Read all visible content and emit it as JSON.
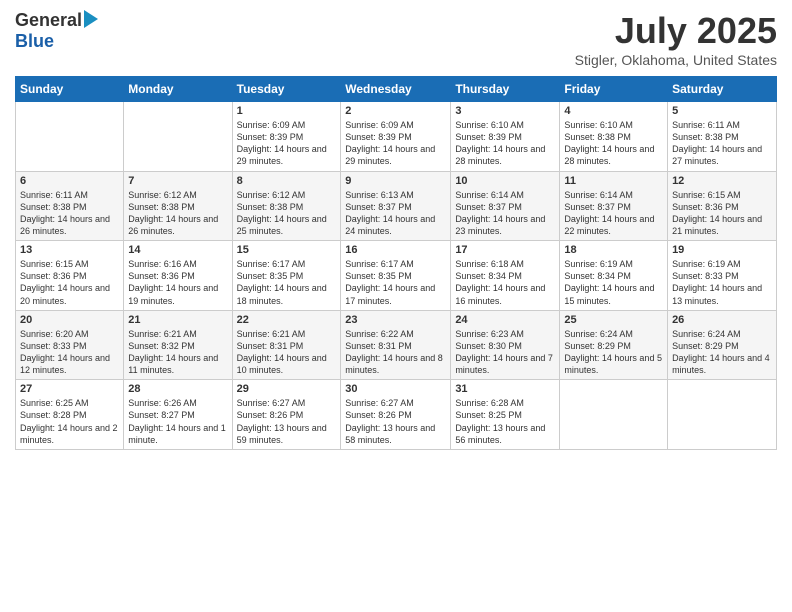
{
  "logo": {
    "general": "General",
    "blue": "Blue"
  },
  "title": "July 2025",
  "subtitle": "Stigler, Oklahoma, United States",
  "days_of_week": [
    "Sunday",
    "Monday",
    "Tuesday",
    "Wednesday",
    "Thursday",
    "Friday",
    "Saturday"
  ],
  "weeks": [
    [
      {
        "day": "",
        "info": ""
      },
      {
        "day": "",
        "info": ""
      },
      {
        "day": "1",
        "info": "Sunrise: 6:09 AM\nSunset: 8:39 PM\nDaylight: 14 hours and 29 minutes."
      },
      {
        "day": "2",
        "info": "Sunrise: 6:09 AM\nSunset: 8:39 PM\nDaylight: 14 hours and 29 minutes."
      },
      {
        "day": "3",
        "info": "Sunrise: 6:10 AM\nSunset: 8:39 PM\nDaylight: 14 hours and 28 minutes."
      },
      {
        "day": "4",
        "info": "Sunrise: 6:10 AM\nSunset: 8:38 PM\nDaylight: 14 hours and 28 minutes."
      },
      {
        "day": "5",
        "info": "Sunrise: 6:11 AM\nSunset: 8:38 PM\nDaylight: 14 hours and 27 minutes."
      }
    ],
    [
      {
        "day": "6",
        "info": "Sunrise: 6:11 AM\nSunset: 8:38 PM\nDaylight: 14 hours and 26 minutes."
      },
      {
        "day": "7",
        "info": "Sunrise: 6:12 AM\nSunset: 8:38 PM\nDaylight: 14 hours and 26 minutes."
      },
      {
        "day": "8",
        "info": "Sunrise: 6:12 AM\nSunset: 8:38 PM\nDaylight: 14 hours and 25 minutes."
      },
      {
        "day": "9",
        "info": "Sunrise: 6:13 AM\nSunset: 8:37 PM\nDaylight: 14 hours and 24 minutes."
      },
      {
        "day": "10",
        "info": "Sunrise: 6:14 AM\nSunset: 8:37 PM\nDaylight: 14 hours and 23 minutes."
      },
      {
        "day": "11",
        "info": "Sunrise: 6:14 AM\nSunset: 8:37 PM\nDaylight: 14 hours and 22 minutes."
      },
      {
        "day": "12",
        "info": "Sunrise: 6:15 AM\nSunset: 8:36 PM\nDaylight: 14 hours and 21 minutes."
      }
    ],
    [
      {
        "day": "13",
        "info": "Sunrise: 6:15 AM\nSunset: 8:36 PM\nDaylight: 14 hours and 20 minutes."
      },
      {
        "day": "14",
        "info": "Sunrise: 6:16 AM\nSunset: 8:36 PM\nDaylight: 14 hours and 19 minutes."
      },
      {
        "day": "15",
        "info": "Sunrise: 6:17 AM\nSunset: 8:35 PM\nDaylight: 14 hours and 18 minutes."
      },
      {
        "day": "16",
        "info": "Sunrise: 6:17 AM\nSunset: 8:35 PM\nDaylight: 14 hours and 17 minutes."
      },
      {
        "day": "17",
        "info": "Sunrise: 6:18 AM\nSunset: 8:34 PM\nDaylight: 14 hours and 16 minutes."
      },
      {
        "day": "18",
        "info": "Sunrise: 6:19 AM\nSunset: 8:34 PM\nDaylight: 14 hours and 15 minutes."
      },
      {
        "day": "19",
        "info": "Sunrise: 6:19 AM\nSunset: 8:33 PM\nDaylight: 14 hours and 13 minutes."
      }
    ],
    [
      {
        "day": "20",
        "info": "Sunrise: 6:20 AM\nSunset: 8:33 PM\nDaylight: 14 hours and 12 minutes."
      },
      {
        "day": "21",
        "info": "Sunrise: 6:21 AM\nSunset: 8:32 PM\nDaylight: 14 hours and 11 minutes."
      },
      {
        "day": "22",
        "info": "Sunrise: 6:21 AM\nSunset: 8:31 PM\nDaylight: 14 hours and 10 minutes."
      },
      {
        "day": "23",
        "info": "Sunrise: 6:22 AM\nSunset: 8:31 PM\nDaylight: 14 hours and 8 minutes."
      },
      {
        "day": "24",
        "info": "Sunrise: 6:23 AM\nSunset: 8:30 PM\nDaylight: 14 hours and 7 minutes."
      },
      {
        "day": "25",
        "info": "Sunrise: 6:24 AM\nSunset: 8:29 PM\nDaylight: 14 hours and 5 minutes."
      },
      {
        "day": "26",
        "info": "Sunrise: 6:24 AM\nSunset: 8:29 PM\nDaylight: 14 hours and 4 minutes."
      }
    ],
    [
      {
        "day": "27",
        "info": "Sunrise: 6:25 AM\nSunset: 8:28 PM\nDaylight: 14 hours and 2 minutes."
      },
      {
        "day": "28",
        "info": "Sunrise: 6:26 AM\nSunset: 8:27 PM\nDaylight: 14 hours and 1 minute."
      },
      {
        "day": "29",
        "info": "Sunrise: 6:27 AM\nSunset: 8:26 PM\nDaylight: 13 hours and 59 minutes."
      },
      {
        "day": "30",
        "info": "Sunrise: 6:27 AM\nSunset: 8:26 PM\nDaylight: 13 hours and 58 minutes."
      },
      {
        "day": "31",
        "info": "Sunrise: 6:28 AM\nSunset: 8:25 PM\nDaylight: 13 hours and 56 minutes."
      },
      {
        "day": "",
        "info": ""
      },
      {
        "day": "",
        "info": ""
      }
    ]
  ]
}
